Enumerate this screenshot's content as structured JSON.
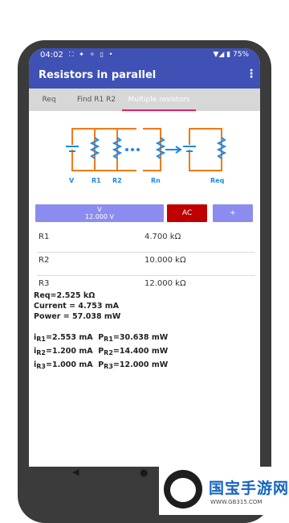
{
  "status_bar": {
    "time": "04:02",
    "icons": "⛶ ✦ ✧ ▯ •",
    "battery": "▼◢ ▮ 75%"
  },
  "app": {
    "title": "Resistors in parallel",
    "menu": "⋮"
  },
  "tabs": [
    {
      "label": "Req"
    },
    {
      "label": "Find R1 R2"
    },
    {
      "label": "Multiple resistors"
    }
  ],
  "circuit_labels": [
    "V",
    "R1",
    "R2",
    "Rn",
    "Req"
  ],
  "controls": {
    "voltage_label": "V",
    "voltage_value": "12.000 V",
    "ac_label": "AC",
    "add_label": "+"
  },
  "resistors": [
    {
      "name": "R1",
      "value": "4.700 kΩ"
    },
    {
      "name": "R2",
      "value": "10.000 kΩ"
    },
    {
      "name": "R3",
      "value": "12.000 kΩ"
    }
  ],
  "results": {
    "req": "Req=2.525 kΩ",
    "current": "Current = 4.753 mA",
    "power": "Power = 57.038 mW"
  },
  "branch_results": [
    {
      "i_sym": "i",
      "i_sub": "R1",
      "i_val": "=2.553 mA",
      "p_sym": "P",
      "p_sub": "R1",
      "p_val": "=30.638 mW"
    },
    {
      "i_sym": "i",
      "i_sub": "R2",
      "i_val": "=1.200 mA",
      "p_sym": "P",
      "p_sub": "R2",
      "p_val": "=14.400 mW"
    },
    {
      "i_sym": "i",
      "i_sub": "R3",
      "i_val": "=1.000 mA",
      "p_sym": "P",
      "p_sub": "R3",
      "p_val": "=12.000 mW"
    }
  ],
  "nav": {
    "back": "◀",
    "home": "●"
  },
  "watermark": {
    "title": "国宝手游网",
    "url": "WWW.GB315.COM"
  },
  "colors": {
    "primary": "#3f51b5",
    "accent": "#e91e63",
    "circuit_orange": "#f07a1a",
    "circuit_blue": "#1e88e5",
    "ac_red": "#c00000",
    "button_purple": "#8c8cf0"
  }
}
